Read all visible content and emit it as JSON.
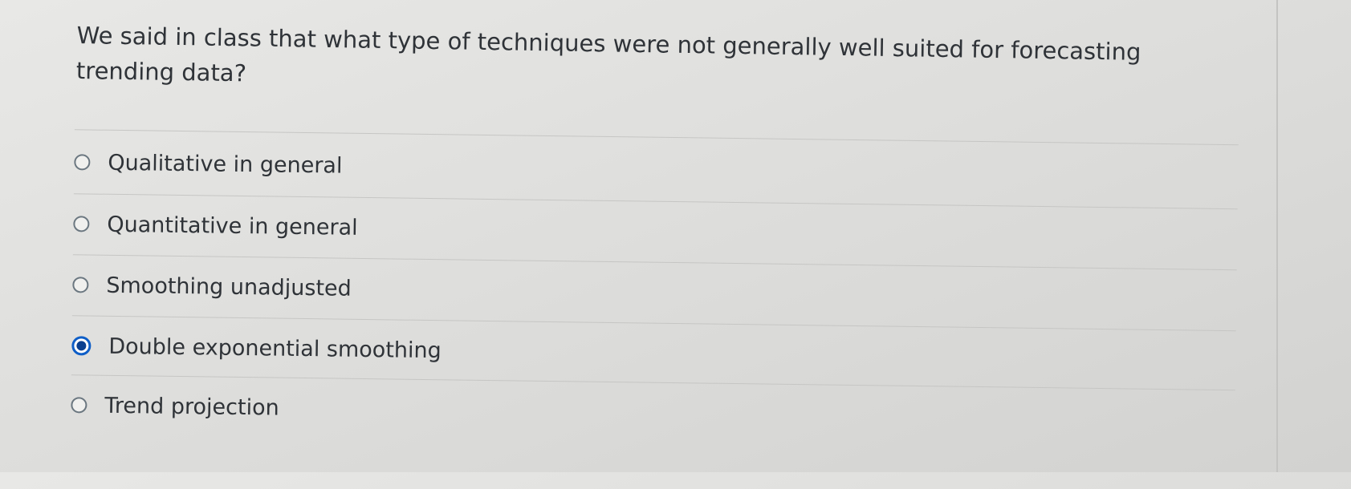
{
  "question": {
    "text": "We said in class that what type of techniques were not generally well suited for forecasting trending data?"
  },
  "answers": [
    {
      "label": "Qualitative in general",
      "selected": false
    },
    {
      "label": "Quantitative in general",
      "selected": false
    },
    {
      "label": "Smoothing unadjusted",
      "selected": false
    },
    {
      "label": "Double exponential smoothing",
      "selected": true
    },
    {
      "label": "Trend projection",
      "selected": false
    }
  ],
  "colors": {
    "selected_radio": "#0e5ec7",
    "text": "#2f3338",
    "divider": "#c6c6c4"
  }
}
